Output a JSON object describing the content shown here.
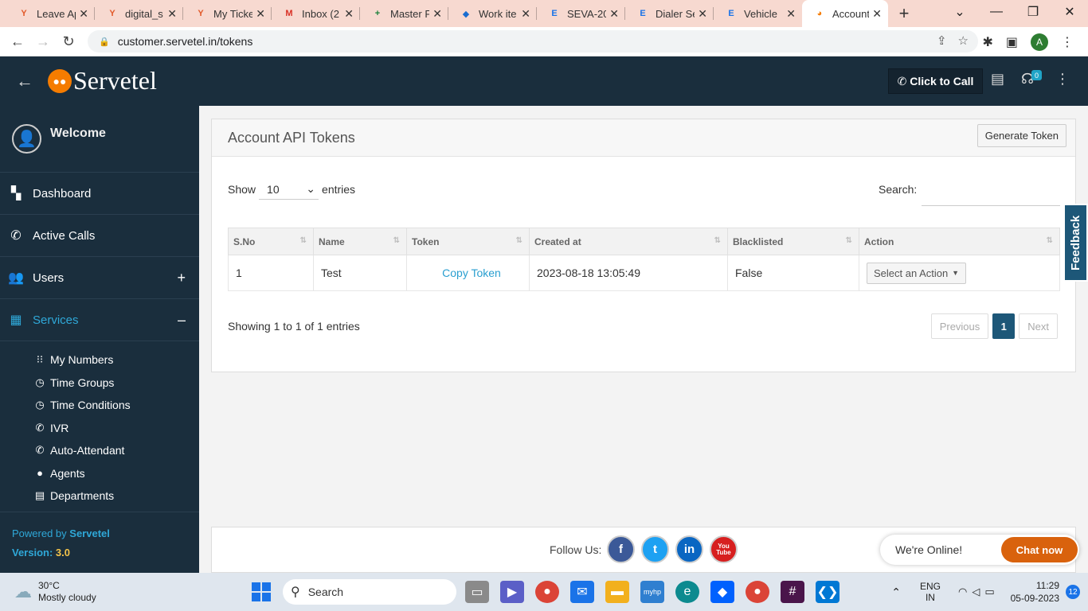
{
  "browser": {
    "tabs": [
      {
        "title": "Leave Ap",
        "fav": "Y",
        "fav_color": "#e25a2a"
      },
      {
        "title": "digital_s",
        "fav": "Y",
        "fav_color": "#e25a2a"
      },
      {
        "title": "My Ticke",
        "fav": "Y",
        "fav_color": "#e25a2a"
      },
      {
        "title": "Inbox (2",
        "fav": "M",
        "fav_color": "#d93025"
      },
      {
        "title": "Master F",
        "fav": "+",
        "fav_color": "#188038"
      },
      {
        "title": "Work ite",
        "fav": "◆",
        "fav_color": "#1a6dd0"
      },
      {
        "title": "SEVA-20",
        "fav": "E",
        "fav_color": "#1a73e8"
      },
      {
        "title": "Dialer Se",
        "fav": "E",
        "fav_color": "#1a73e8"
      },
      {
        "title": "Vehicle",
        "fav": "E",
        "fav_color": "#1a73e8"
      },
      {
        "title": "Account",
        "fav": "◕",
        "fav_color": "#f57c00"
      }
    ],
    "url": "customer.servetel.in/tokens",
    "profile_initial": "A"
  },
  "header": {
    "brand": "Servetel",
    "click_to_call": "Click to Call",
    "badge_count": "0"
  },
  "sidebar": {
    "welcome": "Welcome",
    "items": [
      {
        "label": "Dashboard",
        "icon": "dashboard-icon"
      },
      {
        "label": "Active Calls",
        "icon": "phone-icon"
      },
      {
        "label": "Users",
        "icon": "users-icon"
      },
      {
        "label": "Services",
        "icon": "grid-icon"
      }
    ],
    "services_sub": [
      {
        "label": "My Numbers"
      },
      {
        "label": "Time Groups"
      },
      {
        "label": "Time Conditions"
      },
      {
        "label": "IVR"
      },
      {
        "label": "Auto-Attendant"
      },
      {
        "label": "Agents"
      },
      {
        "label": "Departments"
      }
    ],
    "powered_by_prefix": "Powered by",
    "powered_by_brand": "Servetel",
    "version_label": "Version:",
    "version": "3.0"
  },
  "panel": {
    "title": "Account API Tokens",
    "generate_button": "Generate Token",
    "show_label": "Show",
    "entries_value": "10",
    "entries_label": "entries",
    "search_label": "Search:",
    "columns": [
      "S.No",
      "Name",
      "Token",
      "Created at",
      "Blacklisted",
      "Action"
    ],
    "rows": [
      {
        "sno": "1",
        "name": "Test",
        "token": "Copy Token",
        "created_at": "2023-08-18 13:05:49",
        "blacklisted": "False",
        "action": "Select an Action"
      }
    ],
    "info": "Showing 1 to 1 of 1 entries",
    "pager": {
      "previous": "Previous",
      "current": "1",
      "next": "Next"
    }
  },
  "feedback": "Feedback",
  "footer": {
    "follow_us": "Follow Us:",
    "social": [
      {
        "name": "facebook",
        "glyph": "f",
        "color": "#3b5998"
      },
      {
        "name": "twitter",
        "glyph": "t",
        "color": "#1da1f2"
      },
      {
        "name": "linkedin",
        "glyph": "in",
        "color": "#0a66c2"
      },
      {
        "name": "youtube",
        "glyph": "You Tube",
        "color": "#d71f1f"
      }
    ]
  },
  "chat": {
    "status": "We're Online!",
    "button": "Chat now"
  },
  "taskbar": {
    "temp": "30°C",
    "weather": "Mostly cloudy",
    "search": "Search",
    "lang_top": "ENG",
    "lang_bottom": "IN",
    "time": "11:29",
    "date": "05-09-2023",
    "notifications": "12"
  }
}
